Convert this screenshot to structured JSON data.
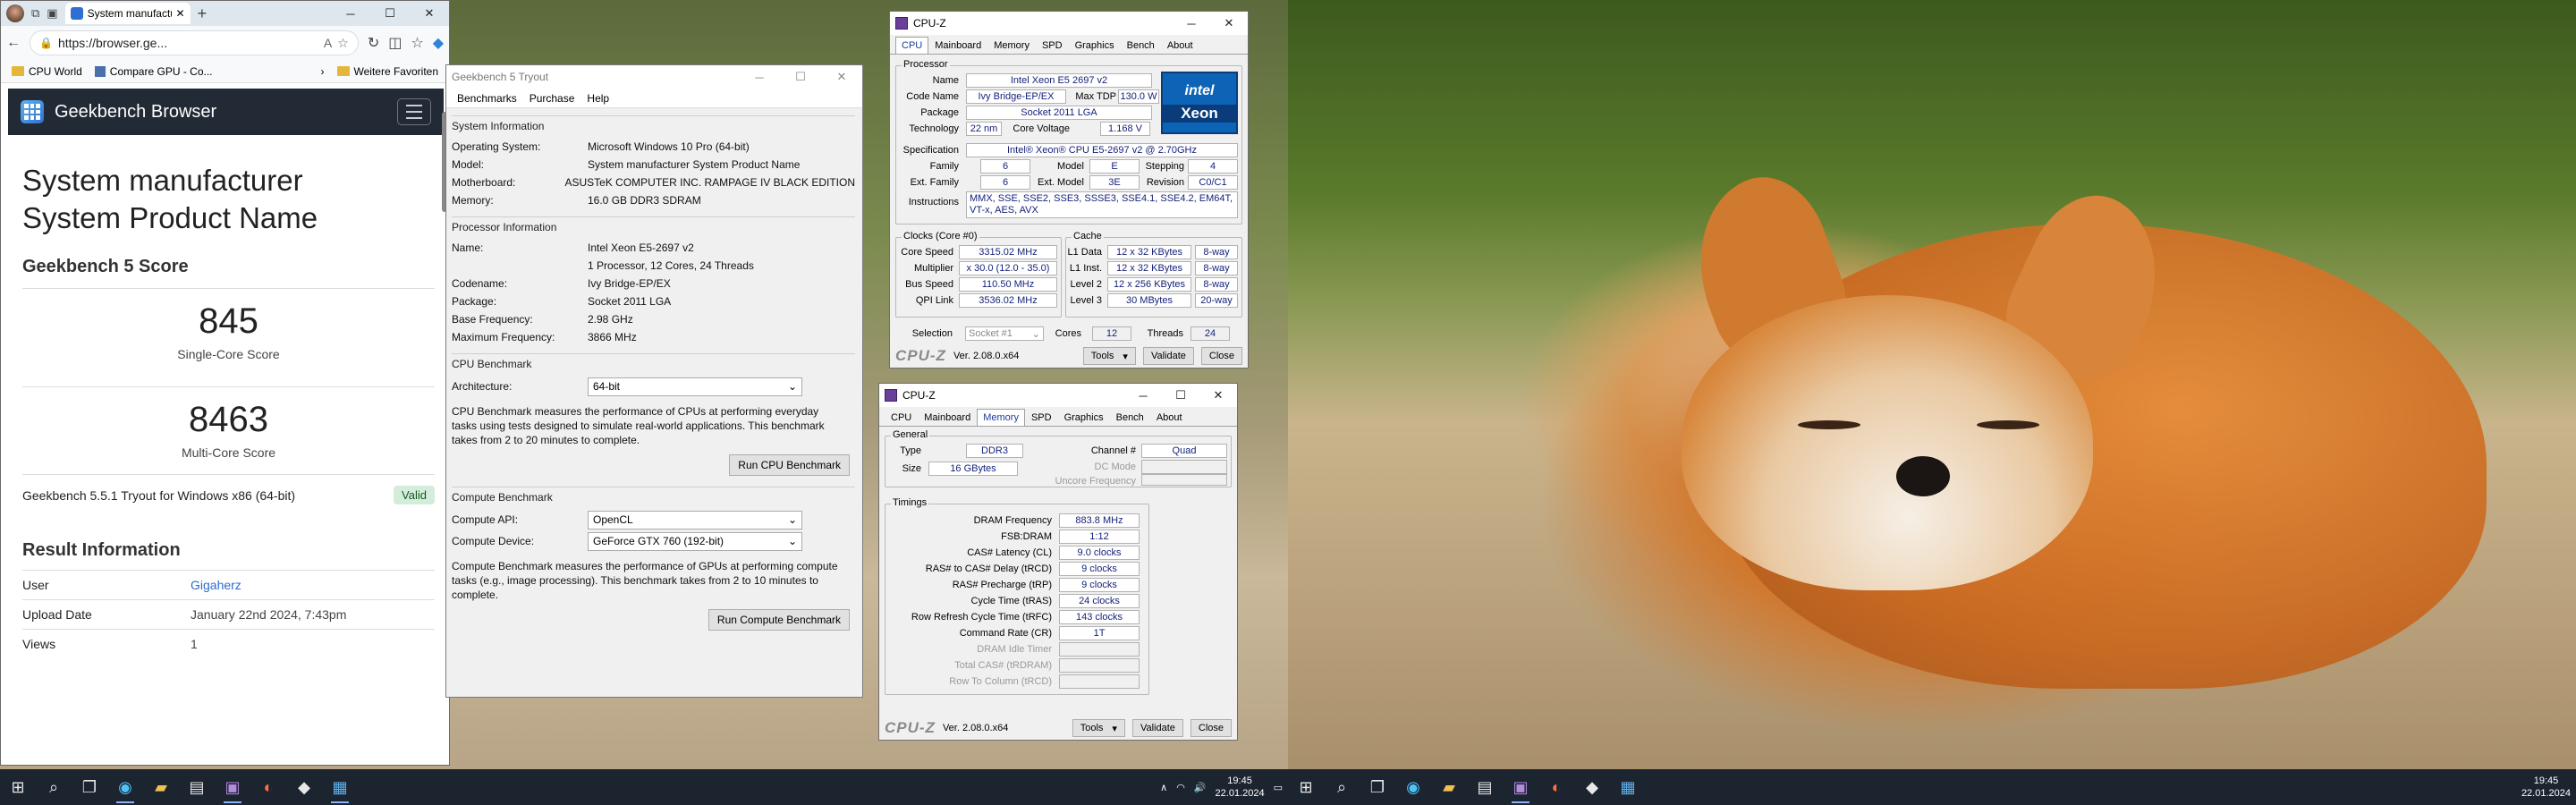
{
  "edge": {
    "tab_title": "System manufactu",
    "url": "https://browser.ge...",
    "favorites": [
      "CPU World",
      "Compare GPU - Co...",
      "Weitere Favoriten"
    ],
    "brand": "Geekbench Browser",
    "title_line1": "System manufacturer",
    "title_line2": "System Product Name",
    "score_heading": "Geekbench 5 Score",
    "single_score": "845",
    "single_label": "Single-Core Score",
    "multi_score": "8463",
    "multi_label": "Multi-Core Score",
    "version_text": "Geekbench 5.5.1 Tryout for Windows x86 (64-bit)",
    "valid_badge": "Valid",
    "result_heading": "Result Information",
    "result_rows": [
      {
        "key": "User",
        "value": "Gigaherz"
      },
      {
        "key": "Upload Date",
        "value": "January 22nd 2024, 7:43pm"
      },
      {
        "key": "Views",
        "value": "1"
      }
    ]
  },
  "geekbench": {
    "title": "Geekbench 5 Tryout",
    "menu": [
      "Benchmarks",
      "Purchase",
      "Help"
    ],
    "sys_title": "System Information",
    "sys_rows": [
      {
        "key": "Operating System:",
        "value": "Microsoft Windows 10 Pro (64-bit)"
      },
      {
        "key": "Model:",
        "value": "System manufacturer System Product Name"
      },
      {
        "key": "Motherboard:",
        "value": "ASUSTeK COMPUTER INC. RAMPAGE IV BLACK EDITION"
      },
      {
        "key": "Memory:",
        "value": "16.0 GB DDR3 SDRAM"
      }
    ],
    "proc_title": "Processor Information",
    "proc_rows": [
      {
        "key": "Name:",
        "value": "Intel Xeon E5-2697 v2"
      },
      {
        "key": "",
        "value": "1 Processor, 12 Cores, 24 Threads"
      },
      {
        "key": "Codename:",
        "value": "Ivy Bridge-EP/EX"
      },
      {
        "key": "Package:",
        "value": "Socket 2011 LGA"
      },
      {
        "key": "Base Frequency:",
        "value": "2.98 GHz"
      },
      {
        "key": "Maximum Frequency:",
        "value": "3866 MHz"
      }
    ],
    "cpu_title": "CPU Benchmark",
    "arch_label": "Architecture:",
    "arch_value": "64-bit",
    "cpu_desc": "CPU Benchmark measures the performance of CPUs at performing everyday tasks using tests designed to simulate real-world applications. This benchmark takes from 2 to 20 minutes to complete.",
    "cpu_button": "Run CPU Benchmark",
    "compute_title": "Compute Benchmark",
    "api_label": "Compute API:",
    "api_value": "OpenCL",
    "device_label": "Compute Device:",
    "device_value": "GeForce GTX 760 (192-bit)",
    "compute_desc": "Compute Benchmark measures the performance of GPUs at performing compute tasks (e.g., image processing). This benchmark takes from 2 to 10 minutes to complete.",
    "compute_button": "Run Compute Benchmark"
  },
  "cpuz1": {
    "title": "CPU-Z",
    "tabs": [
      "CPU",
      "Mainboard",
      "Memory",
      "SPD",
      "Graphics",
      "Bench",
      "About"
    ],
    "processor_group": "Processor",
    "name_label": "Name",
    "name": "Intel Xeon E5 2697 v2",
    "codename_label": "Code Name",
    "codename": "Ivy Bridge-EP/EX",
    "maxtdp_label": "Max TDP",
    "maxtdp": "130.0 W",
    "package_label": "Package",
    "package": "Socket 2011 LGA",
    "technology_label": "Technology",
    "technology": "22 nm",
    "voltage_label": "Core Voltage",
    "voltage": "1.168 V",
    "spec_label": "Specification",
    "spec": "Intel® Xeon® CPU E5-2697 v2 @ 2.70GHz",
    "family_label": "Family",
    "family": "6",
    "model_label": "Model",
    "model": "E",
    "stepping_label": "Stepping",
    "stepping": "4",
    "extfamily_label": "Ext. Family",
    "extfamily": "6",
    "extmodel_label": "Ext. Model",
    "extmodel": "3E",
    "revision_label": "Revision",
    "revision": "C0/C1",
    "instr_label": "Instructions",
    "instructions": "MMX, SSE, SSE2, SSE3, SSSE3, SSE4.1, SSE4.2, EM64T, VT-x, AES, AVX",
    "intel_logo_top": "intel",
    "intel_logo_bottom": "Xeon",
    "clocks_group": "Clocks (Core #0)",
    "corespeed_label": "Core Speed",
    "corespeed": "3315.02 MHz",
    "multiplier_label": "Multiplier",
    "multiplier": "x 30.0 (12.0 - 35.0)",
    "busspeed_label": "Bus Speed",
    "busspeed": "110.50 MHz",
    "qpi_label": "QPI Link",
    "qpi": "3536.02 MHz",
    "cache_group": "Cache",
    "l1d_label": "L1 Data",
    "l1d": "12 x 32 KBytes",
    "l1d_way": "8-way",
    "l1i_label": "L1 Inst.",
    "l1i": "12 x 32 KBytes",
    "l1i_way": "8-way",
    "l2_label": "Level 2",
    "l2": "12 x 256 KBytes",
    "l2_way": "8-way",
    "l3_label": "Level 3",
    "l3": "30 MBytes",
    "l3_way": "20-way",
    "selection_label": "Selection",
    "selection": "Socket #1",
    "cores_label": "Cores",
    "cores": "12",
    "threads_label": "Threads",
    "threads": "24",
    "logo": "CPU-Z",
    "version": "Ver. 2.08.0.x64",
    "tools": "Tools",
    "validate": "Validate",
    "close": "Close"
  },
  "cpuz2": {
    "title": "CPU-Z",
    "tabs": [
      "CPU",
      "Mainboard",
      "Memory",
      "SPD",
      "Graphics",
      "Bench",
      "About"
    ],
    "general_group": "General",
    "type_label": "Type",
    "type": "DDR3",
    "size_label": "Size",
    "size": "16 GBytes",
    "channel_label": "Channel #",
    "channel": "Quad",
    "dcmode_label": "DC Mode",
    "uncore_label": "Uncore Frequency",
    "timings_group": "Timings",
    "timings": [
      {
        "label": "DRAM Frequency",
        "value": "883.8 MHz"
      },
      {
        "label": "FSB:DRAM",
        "value": "1:12"
      },
      {
        "label": "CAS# Latency (CL)",
        "value": "9.0 clocks"
      },
      {
        "label": "RAS# to CAS# Delay (tRCD)",
        "value": "9 clocks"
      },
      {
        "label": "RAS# Precharge (tRP)",
        "value": "9 clocks"
      },
      {
        "label": "Cycle Time (tRAS)",
        "value": "24 clocks"
      },
      {
        "label": "Row Refresh Cycle Time (tRFC)",
        "value": "143 clocks"
      },
      {
        "label": "Command Rate (CR)",
        "value": "1T"
      },
      {
        "label": "DRAM Idle Timer",
        "value": ""
      },
      {
        "label": "Total CAS# (tRDRAM)",
        "value": ""
      },
      {
        "label": "Row To Column (tRCD)",
        "value": ""
      }
    ],
    "logo": "CPU-Z",
    "version": "Ver. 2.08.0.x64",
    "tools": "Tools",
    "validate": "Validate",
    "close": "Close"
  },
  "taskbar": {
    "time": "19:45",
    "date": "22.01.2024"
  },
  "colors": {
    "cpuz_value": "#121f78",
    "edge_link": "#2d6bcf",
    "valid_bg": "#d4edda",
    "gb_header": "#222a36"
  }
}
